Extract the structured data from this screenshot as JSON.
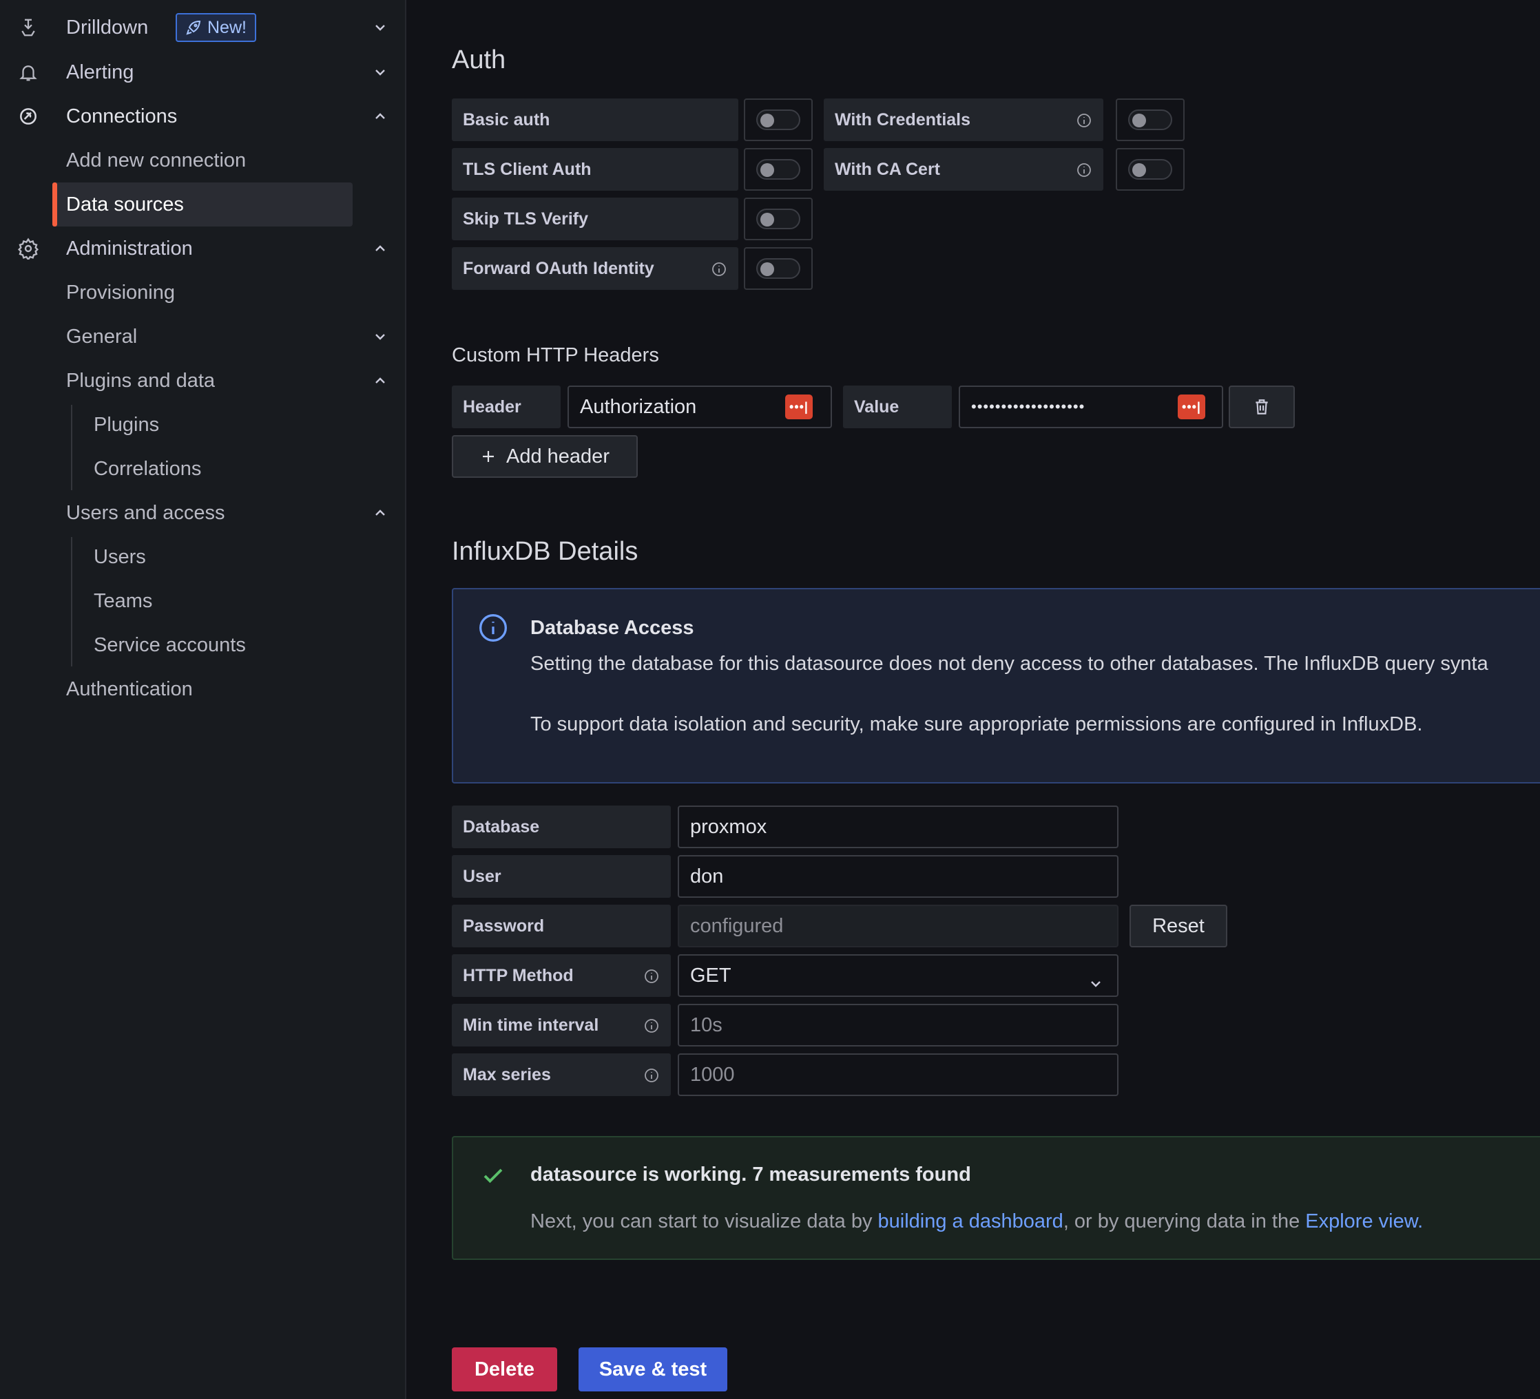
{
  "nav": {
    "drilldown": "Drilldown",
    "new_badge": "New!",
    "alerting": "Alerting",
    "connections": "Connections",
    "add_new_connection": "Add new connection",
    "data_sources": "Data sources",
    "administration": "Administration",
    "provisioning": "Provisioning",
    "general": "General",
    "plugins_and_data": "Plugins and data",
    "plugins": "Plugins",
    "correlations": "Correlations",
    "users_and_access": "Users and access",
    "users": "Users",
    "teams": "Teams",
    "service_accounts": "Service accounts",
    "authentication": "Authentication"
  },
  "auth": {
    "title": "Auth",
    "basic_auth": "Basic auth",
    "with_credentials": "With Credentials",
    "tls_client_auth": "TLS Client Auth",
    "with_ca_cert": "With CA Cert",
    "skip_tls_verify": "Skip TLS Verify",
    "forward_oauth": "Forward OAuth Identity"
  },
  "headers": {
    "title": "Custom HTTP Headers",
    "header_label": "Header",
    "header_value": "Authorization",
    "value_label": "Value",
    "value_masked": "•••••••••••••••••••",
    "add_header": "Add header"
  },
  "influx": {
    "title": "InfluxDB Details",
    "alert_title": "Database Access",
    "alert_line1": "Setting the database for this datasource does not deny access to other databases. The InfluxDB query synta",
    "alert_line2": "To support data isolation and security, make sure appropriate permissions are configured in InfluxDB.",
    "database_label": "Database",
    "database_value": "proxmox",
    "user_label": "User",
    "user_value": "don",
    "password_label": "Password",
    "password_value": "configured",
    "reset": "Reset",
    "http_method_label": "HTTP Method",
    "http_method_value": "GET",
    "min_time_label": "Min time interval",
    "min_time_placeholder": "10s",
    "max_series_label": "Max series",
    "max_series_placeholder": "1000"
  },
  "status": {
    "title": "datasource is working. 7 measurements found",
    "text_pre": "Next, you can start to visualize data by ",
    "link1": "building a dashboard",
    "text_mid": ", or by querying data in the ",
    "link2": "Explore view",
    "text_post": "."
  },
  "actions": {
    "delete": "Delete",
    "save_test": "Save & test"
  },
  "colors": {
    "accent_active": "#f55f3e",
    "primary": "#3d5ed6",
    "danger": "#c22a4c",
    "success": "#5ac06a",
    "link": "#6e9fff"
  }
}
